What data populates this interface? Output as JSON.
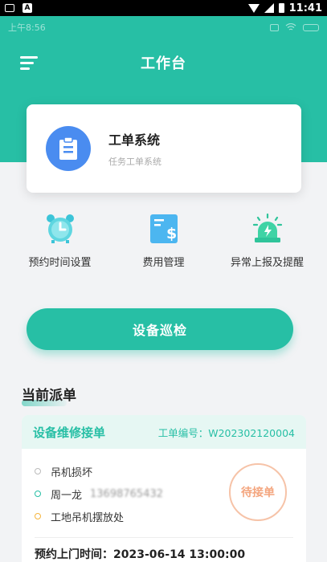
{
  "android_status": {
    "time": "11:41"
  },
  "inner_status": {
    "time": "上午8:56"
  },
  "header": {
    "title": "工作台"
  },
  "system_card": {
    "title": "工单系统",
    "subtitle": "任务工单系统"
  },
  "quick_menu": [
    {
      "label": "预约时间设置",
      "icon": "alarm-clock-icon"
    },
    {
      "label": "费用管理",
      "icon": "money-bill-icon"
    },
    {
      "label": "异常上报及提醒",
      "icon": "warning-light-icon"
    }
  ],
  "primary_action": {
    "label": "设备巡检"
  },
  "current_orders": {
    "section_title": "当前派单",
    "order": {
      "type": "设备维修接单",
      "number": "工单编号：W202302120004",
      "issue": "吊机损坏",
      "contact_name": "周一龙",
      "contact_phone": "13698765432",
      "location": "工地吊机摆放处",
      "status": "待接单",
      "appointment": "预约上门时间：2023-06-14 13:00:00"
    }
  },
  "colors": {
    "brand": "#27bfa5",
    "card_blue": "#4a8cf0",
    "stamp": "#f4a57e"
  }
}
